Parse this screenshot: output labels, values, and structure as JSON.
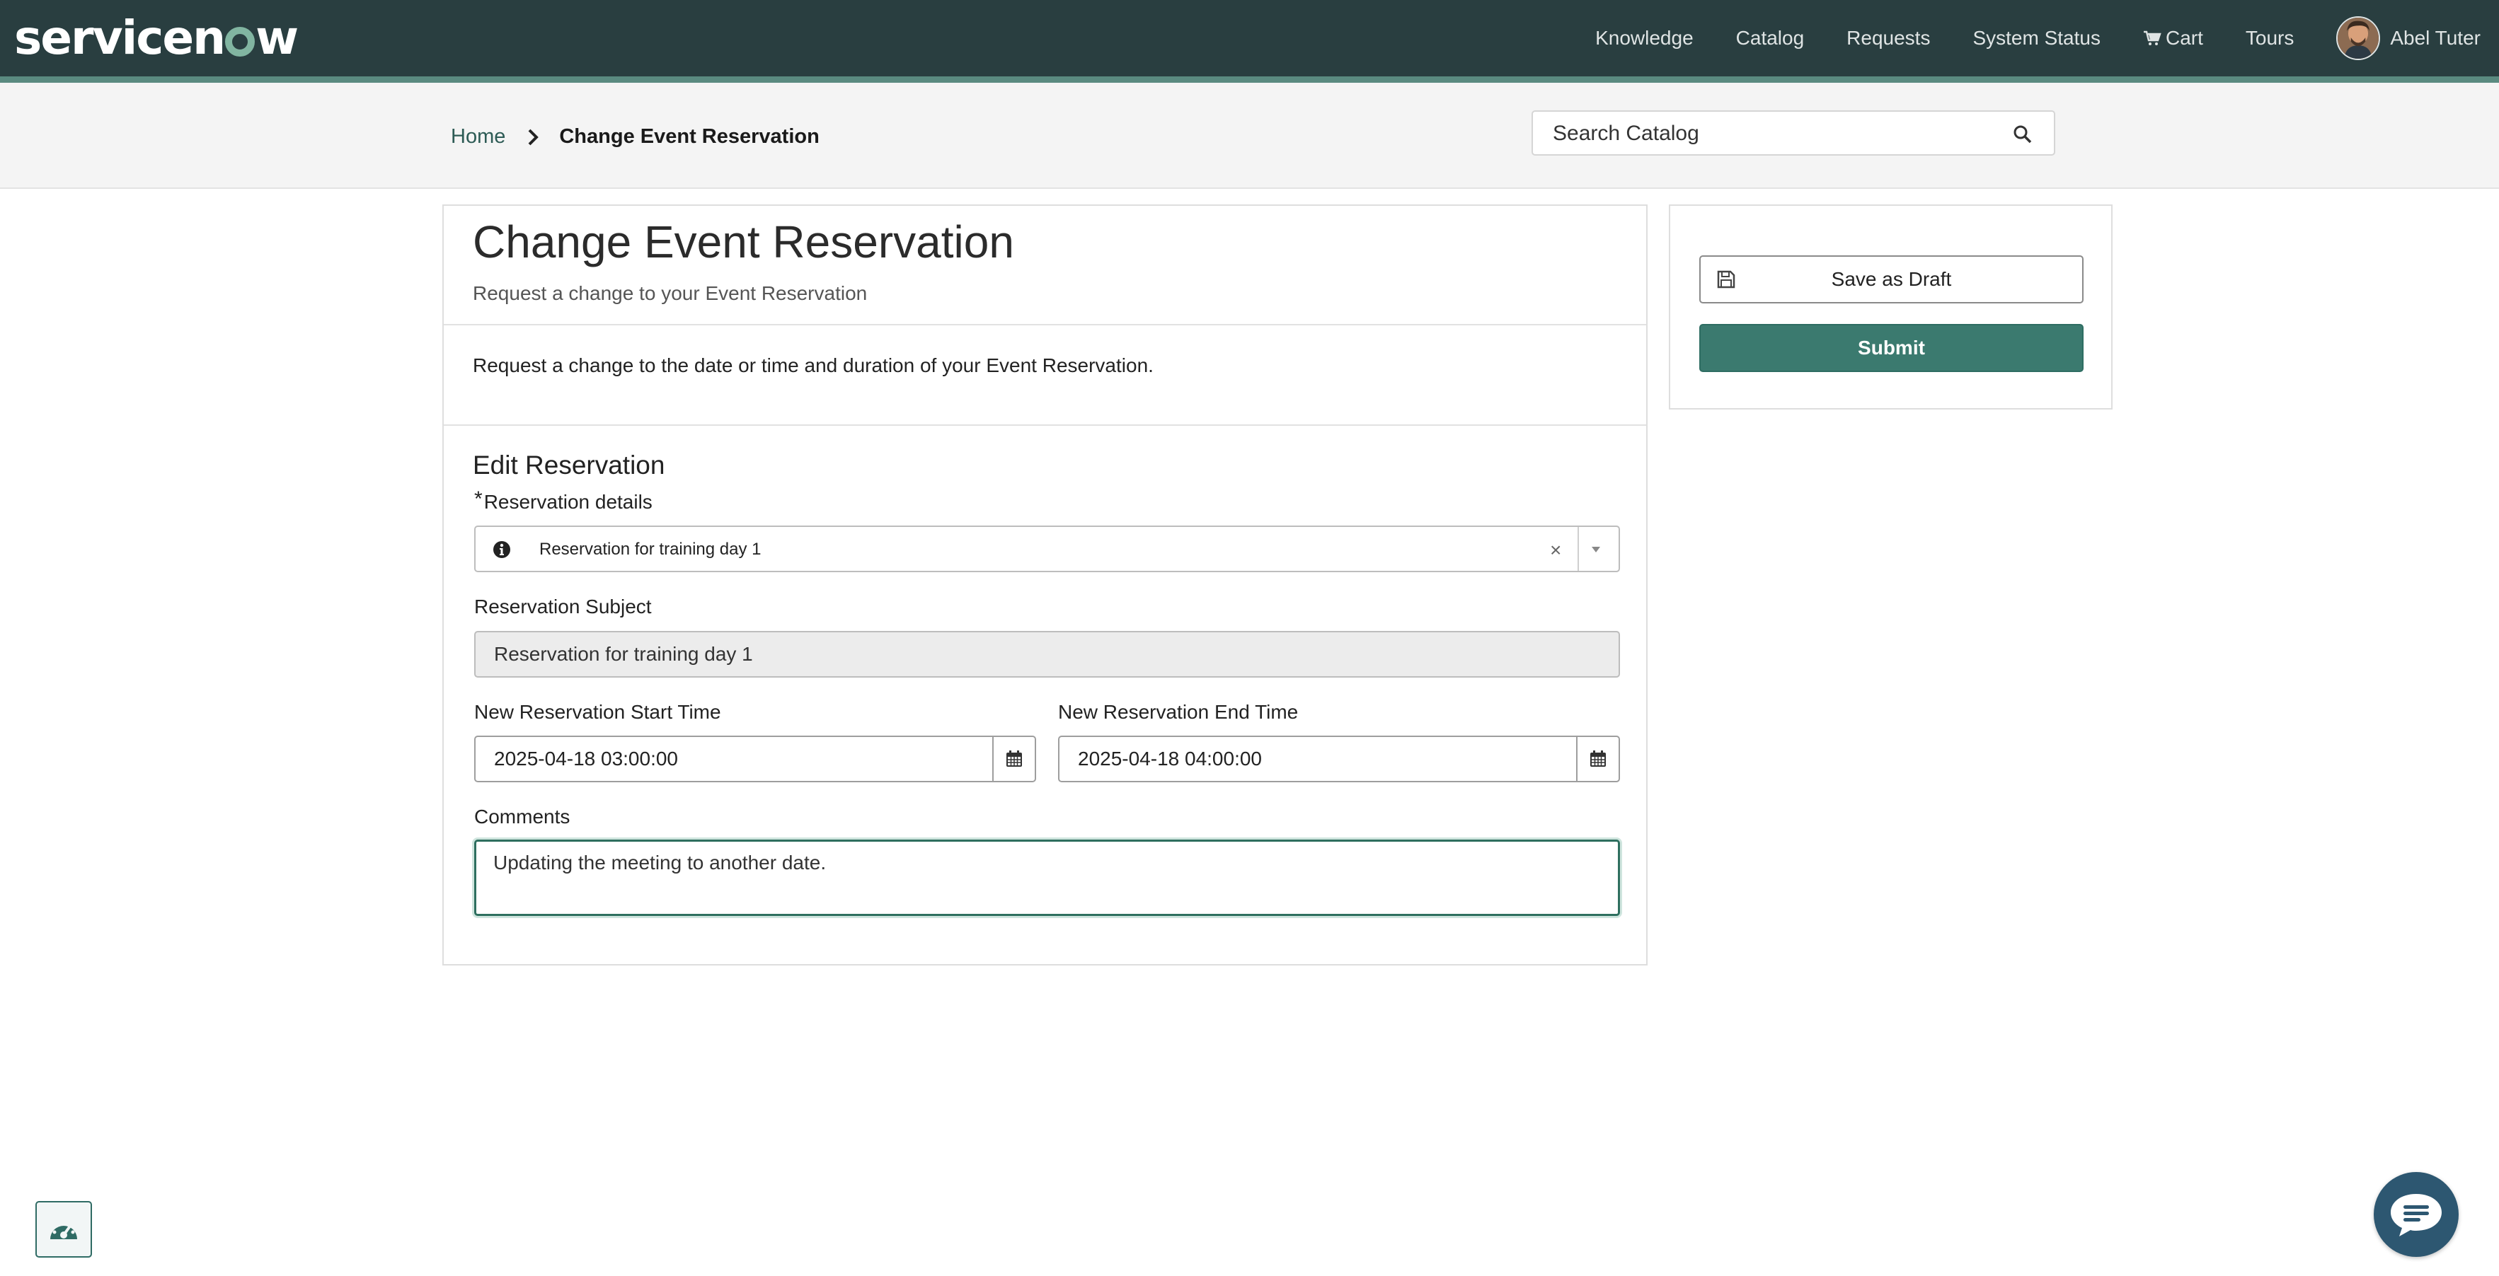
{
  "brand": {
    "logo_prefix": "servicen",
    "logo_suffix": "w",
    "colors": {
      "nav_bg": "#293e40",
      "accent": "#81b5a1",
      "primary_button": "#3b7a6f"
    }
  },
  "nav": {
    "items": [
      "Knowledge",
      "Catalog",
      "Requests",
      "System Status"
    ],
    "cart_label": "Cart",
    "tours_label": "Tours",
    "user_name": "Abel Tuter"
  },
  "breadcrumb": {
    "home": "Home",
    "current": "Change Event Reservation"
  },
  "search": {
    "placeholder": "Search Catalog",
    "value": ""
  },
  "form": {
    "title": "Change Event Reservation",
    "subtitle": "Request a change to your Event Reservation",
    "description": "Request a change to the date or time and duration of your Event Reservation.",
    "section_title": "Edit Reservation",
    "reservation_details": {
      "label": "Reservation details",
      "required_mark": "*",
      "value": "Reservation for training day 1",
      "clear_symbol": "×"
    },
    "reservation_subject": {
      "label": "Reservation Subject",
      "value": "Reservation for training day 1"
    },
    "start_time": {
      "label": "New Reservation Start Time",
      "value": "2025-04-18 03:00:00"
    },
    "end_time": {
      "label": "New Reservation End Time",
      "value": "2025-04-18 04:00:00"
    },
    "comments": {
      "label": "Comments",
      "value": "Updating the meeting to another date."
    }
  },
  "actions": {
    "save_draft": "Save as Draft",
    "submit": "Submit"
  },
  "icons": [
    "cart-icon",
    "avatar",
    "chevron-right-icon",
    "search-icon",
    "info-icon",
    "close-icon",
    "chevron-down-icon",
    "calendar-icon",
    "floppy-disk-icon",
    "dashboard-gauge-icon",
    "chat-bubble-icon"
  ]
}
